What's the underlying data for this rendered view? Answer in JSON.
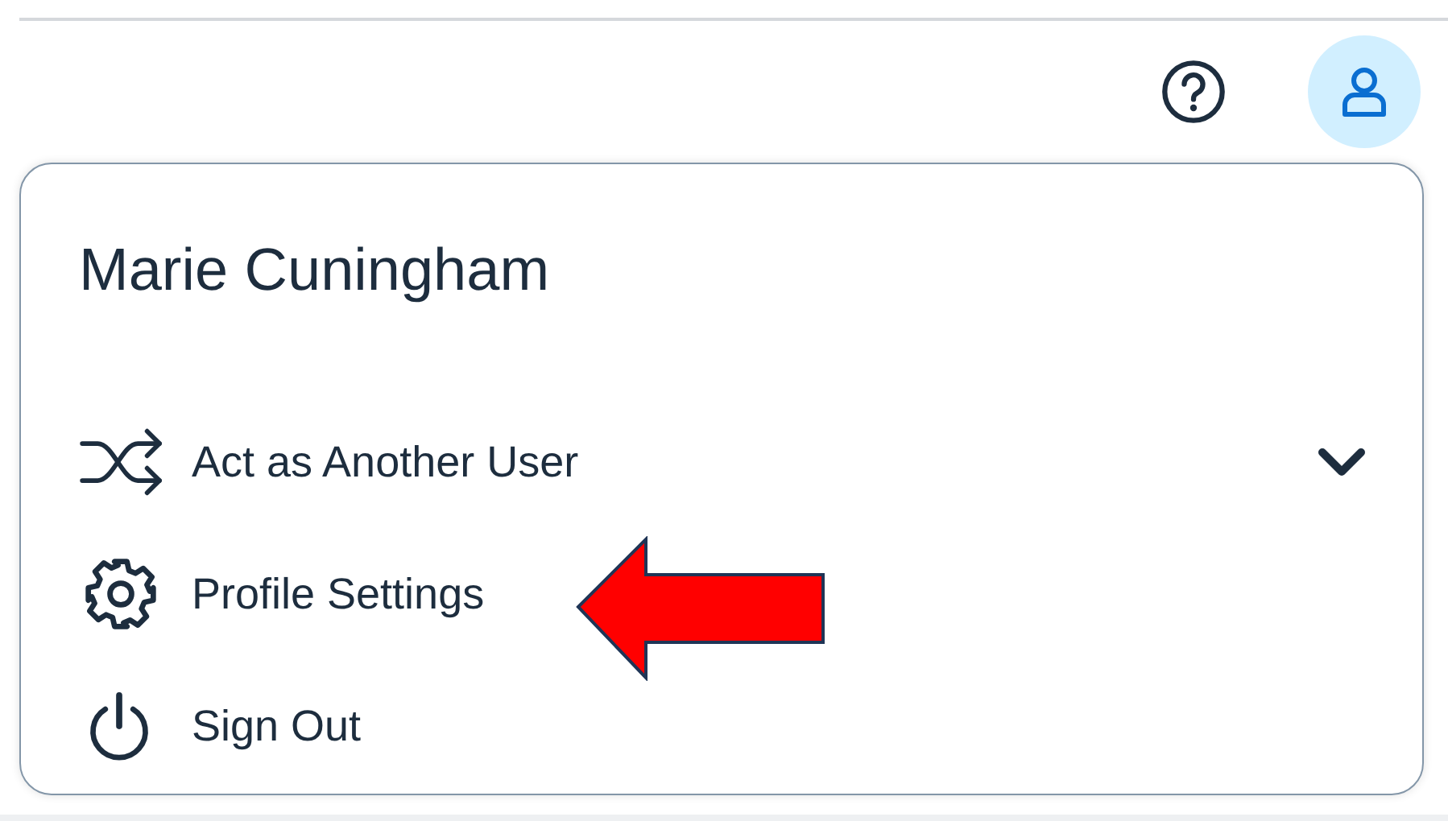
{
  "header": {
    "actions": [
      {
        "kind": "help"
      },
      {
        "kind": "profile",
        "selected": true
      }
    ]
  },
  "user_menu": {
    "user_name": "Marie Cuningham",
    "items": [
      {
        "kind": "switch-user",
        "label": "Act as Another User",
        "expanded": false
      },
      {
        "kind": "settings",
        "label": "Profile Settings"
      },
      {
        "kind": "sign-out",
        "label": "Sign Out"
      }
    ]
  }
}
